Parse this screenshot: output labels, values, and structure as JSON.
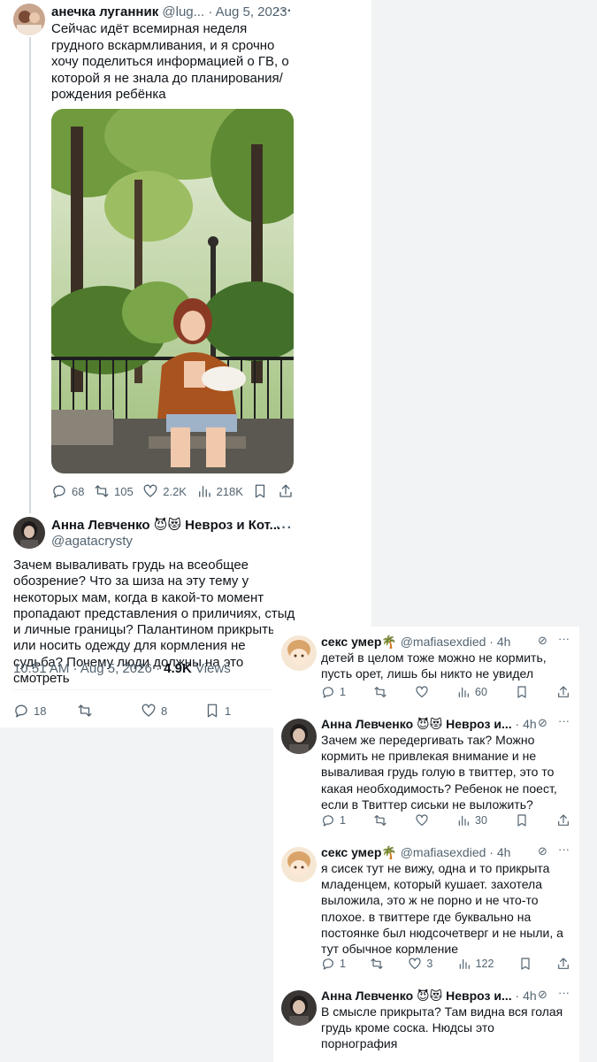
{
  "original_tweet": {
    "display_name": "анечка луганник",
    "handle": "@lug...",
    "date": "· Aug 5, 2023",
    "text": "Сейчас идёт всемирная неделя грудного вскармливания, и я срочно хочу поделиться информацией о ГВ, о которой я не знала до планирования/рождения ребёнка",
    "stats": {
      "replies": "68",
      "reposts": "105",
      "likes": "2.2K",
      "views": "218K"
    }
  },
  "quote_reply": {
    "display_name": "Анна Левченко 😈😻 Невроз и Кот...",
    "handle": "@agatacrysty",
    "text": "Зачем вываливать грудь на всеобщее обозрение? Что за шиза на эту тему у некоторых мам, когда в какой-то момент пропадают представления о приличиях, стыд и личные границы? Палантином прикрыться или носить одежду для кормления не судьба? Почему люди должны на это смотреть",
    "time": "10:51 AM · Aug 5, 2026 ·",
    "views_count": "4.9K",
    "views_label": "Views",
    "stats": {
      "replies": "18",
      "likes": "8",
      "bookmarks": "1"
    }
  },
  "replies": [
    {
      "display_name": "секс умер🌴",
      "handle": "@mafiasexdied",
      "time": "· 4h",
      "text": "детей в целом тоже можно не кормить, пусть орет, лишь бы никто не увидел",
      "replies": "1",
      "reposts": "",
      "likes": "",
      "views": "60"
    },
    {
      "display_name": "Анна Левченко 😈😻 Невроз и...",
      "handle": "",
      "time": "· 4h",
      "text": "Зачем же передергивать так? Можно кормить не привлекая внимание и не вываливая грудь голую в твиттер, это то какая необходимость? Ребенок не поест, если в Твиттер сиськи не выложить?",
      "replies": "1",
      "reposts": "",
      "likes": "",
      "views": "30"
    },
    {
      "display_name": "секс умер🌴",
      "handle": "@mafiasexdied",
      "time": "· 4h",
      "text": "я сисек тут не вижу, одна и то прикрыта младенцем, который кушает. захотела выложила, это ж не порно и не что-то плохое. в твиттере где буквально на постоянке был нюдсочетверг и не ныли, а тут обычное кормление",
      "replies": "1",
      "reposts": "",
      "likes": "3",
      "views": "122"
    },
    {
      "display_name": "Анна Левченко 😈😻 Невроз и...",
      "handle": "",
      "time": "· 4h",
      "text": "В смысле прикрыта? Там видна вся голая грудь кроме соска. Нюдсы это порнография"
    }
  ],
  "icons": {
    "reply": "reply-icon",
    "repost": "repost-icon",
    "like": "heart-icon",
    "views": "views-icon",
    "bookmark": "bookmark-icon",
    "share": "share-icon",
    "more": "more-icon",
    "grok": "grok-icon"
  },
  "colors": {
    "text": "#0f1419",
    "muted": "#536471",
    "divider": "#eff3f4",
    "background_gray": "#f2f3f4"
  }
}
